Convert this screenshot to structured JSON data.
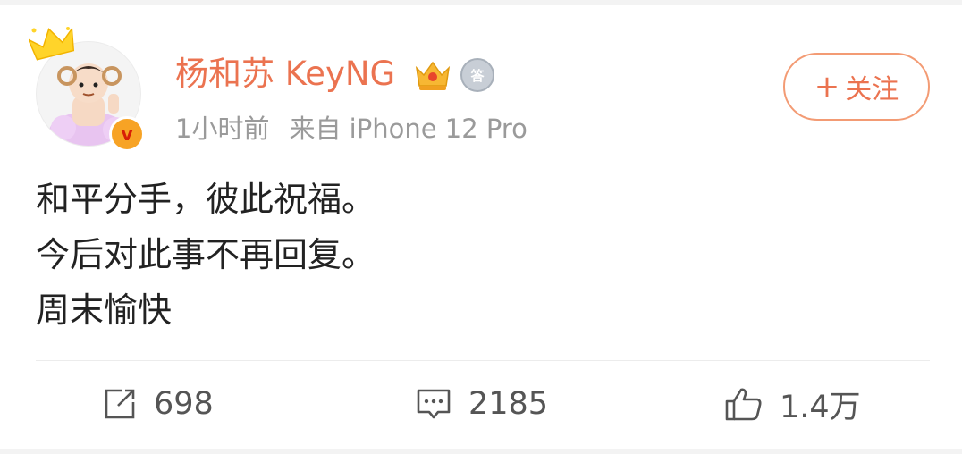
{
  "user": {
    "name": "杨和苏 KeyNG",
    "verified_mark": "v"
  },
  "post": {
    "time": "1小时前",
    "source": "来自 iPhone 12 Pro",
    "lines": [
      "和平分手，彼此祝福。",
      "今后对此事不再回复。",
      "周末愉快"
    ]
  },
  "follow_button": {
    "plus": "+",
    "label": "关注"
  },
  "actions": {
    "repost_count": "698",
    "comment_count": "2185",
    "like_count": "1.4万"
  },
  "colors": {
    "accent": "#eb7350",
    "follow_border": "#f39b74",
    "meta": "#9a9a9a"
  },
  "icons": {
    "avatar_crown": "crown-icon",
    "badge1": "gem-crown-icon",
    "badge2": "medal-icon",
    "repost": "repost-icon",
    "comment": "comment-icon",
    "like": "thumbs-up-icon"
  }
}
